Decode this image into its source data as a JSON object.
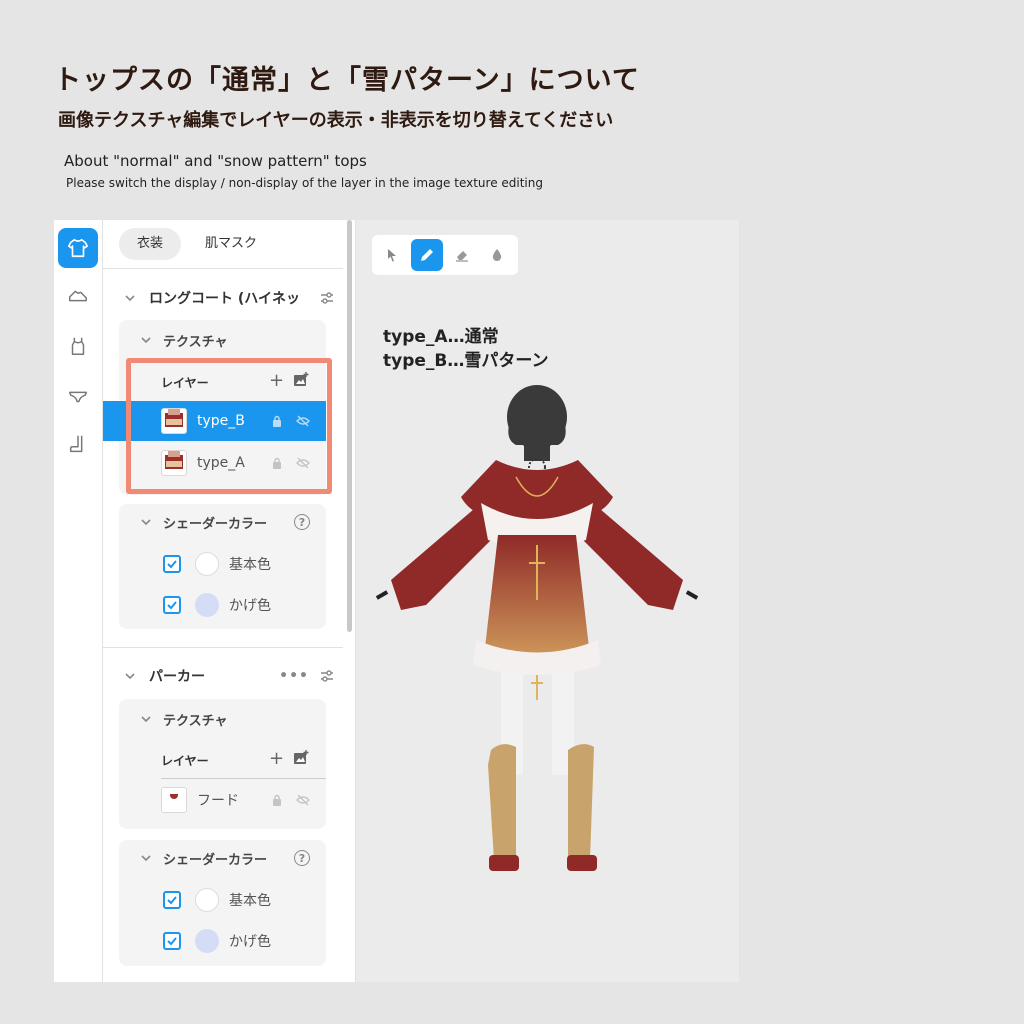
{
  "header": {
    "title_jp": "トップスの「通常」と「雪パターン」について",
    "subtitle_jp": "画像テクスチャ編集でレイヤーの表示・非表示を切り替えてください",
    "title_en": "About \"normal\" and \"snow pattern\" tops",
    "subtitle_en": "Please switch the display / non-display of the layer in the image texture editing"
  },
  "rail": {
    "items": [
      {
        "icon": "shirt-icon",
        "active": true
      },
      {
        "icon": "shoe-icon",
        "active": false
      },
      {
        "icon": "tank-top-icon",
        "active": false
      },
      {
        "icon": "underwear-icon",
        "active": false
      },
      {
        "icon": "sock-icon",
        "active": false
      }
    ]
  },
  "panel": {
    "tabs": [
      "衣装",
      "肌マスク"
    ],
    "active_tab": 0,
    "sections": [
      {
        "title": "ロングコート (ハイネッ",
        "texture_label": "テクスチャ",
        "layer_label": "レイヤー",
        "layers": [
          {
            "name": "type_B",
            "selected": true
          },
          {
            "name": "type_A",
            "selected": false
          }
        ],
        "shader_label": "シェーダーカラー",
        "colors": [
          {
            "label": "基本色",
            "color": "#ffffff",
            "checked": true
          },
          {
            "label": "かげ色",
            "color": "#d4dcf6",
            "checked": true
          }
        ]
      },
      {
        "title": "パーカー",
        "texture_label": "テクスチャ",
        "layer_label": "レイヤー",
        "layers": [
          {
            "name": "フード",
            "selected": false
          }
        ],
        "shader_label": "シェーダーカラー",
        "colors": [
          {
            "label": "基本色",
            "color": "#ffffff",
            "checked": true
          },
          {
            "label": "かげ色",
            "color": "#d4dcf6",
            "checked": true
          }
        ]
      }
    ]
  },
  "viewport": {
    "tools": [
      "select-tool",
      "pen-tool",
      "eraser-tool",
      "fill-tool"
    ],
    "active_tool": "pen-tool",
    "note_line1": "type_A…通常",
    "note_line2": "type_B…雪パターン"
  },
  "colors": {
    "accent": "#1a96ee",
    "highlight_box": "#f08a75",
    "coat": "#9b2f2d"
  }
}
